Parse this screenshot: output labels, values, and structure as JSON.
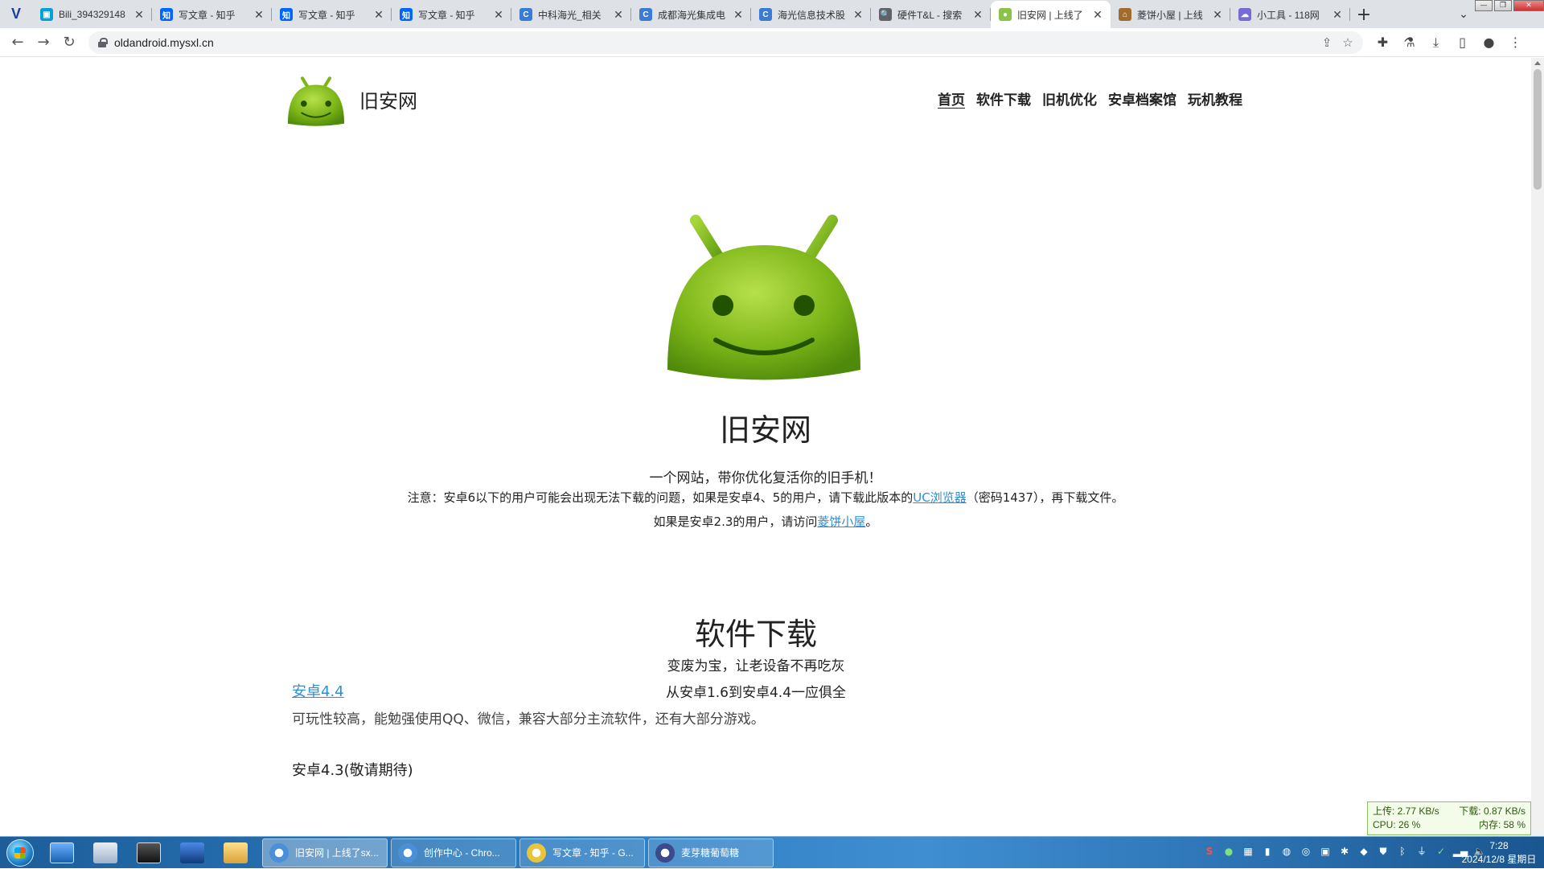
{
  "browser": {
    "tabs": [
      {
        "title": "Bili_394329148",
        "fav_color": "#00a1d6",
        "fav_glyph": "▣"
      },
      {
        "title": "写文章 - 知乎",
        "fav_color": "#0066ff",
        "fav_glyph": "知"
      },
      {
        "title": "写文章 - 知乎",
        "fav_color": "#0066ff",
        "fav_glyph": "知"
      },
      {
        "title": "写文章 - 知乎",
        "fav_color": "#0066ff",
        "fav_glyph": "知"
      },
      {
        "title": "中科海光_相关",
        "fav_color": "#3a7bd5",
        "fav_glyph": "C"
      },
      {
        "title": "成都海光集成电",
        "fav_color": "#3a7bd5",
        "fav_glyph": "C"
      },
      {
        "title": "海光信息技术股",
        "fav_color": "#3a7bd5",
        "fav_glyph": "C"
      },
      {
        "title": "硬件T&L - 搜索",
        "fav_color": "#5f6368",
        "fav_glyph": "🔍"
      },
      {
        "title": "旧安网 | 上线了",
        "fav_color": "#8bc34a",
        "fav_glyph": "●",
        "active": true
      },
      {
        "title": "菱饼小屋 | 上线",
        "fav_color": "#a36b2b",
        "fav_glyph": "⌂"
      },
      {
        "title": "小工具 - 118网",
        "fav_color": "#7a6ad8",
        "fav_glyph": "☁"
      }
    ],
    "new_tab_label": "+",
    "url": "oldandroid.mysxl.cn",
    "window_controls": [
      "—",
      "❐",
      "✕"
    ]
  },
  "site": {
    "name": "旧安网",
    "nav": [
      "首页",
      "软件下载",
      "旧机优化",
      "安卓档案馆",
      "玩机教程"
    ],
    "hero_title": "旧安网",
    "tagline": "一个网站，带你优化复活你的旧手机！",
    "notice_pre": "注意：安卓6以下的用户可能会出现无法下载的问题，如果是安卓4、5的用户，请下载此版本的",
    "notice_link": "UC浏览器",
    "notice_post": "（密码1437），再下载文件。",
    "android23_pre": "如果是安卓2.3的用户，请访问",
    "android23_link": "菱饼小屋",
    "android23_post": "。",
    "section_title": "软件下载",
    "section_sub1": "变废为宝，让老设备不再吃灰",
    "section_sub2": "从安卓1.6到安卓4.4一应俱全",
    "item1_link": "安卓4.4",
    "item1_desc": "可玩性较高，能勉强使用QQ、微信，兼容大部分主流软件，还有大部分游戏。",
    "item2_title": "安卓4.3(敬请期待)",
    "android_green": "#8bc34a"
  },
  "netmon": {
    "upload": "上传: 2.77 KB/s",
    "download": "下载: 0.87 KB/s",
    "cpu": "CPU: 26 %",
    "mem": "内存: 58 %"
  },
  "taskbar": {
    "tasks": [
      {
        "label": "旧安网 | 上线了sx...",
        "active": true
      },
      {
        "label": "创作中心 - Chro..."
      },
      {
        "label": "写文章 - 知乎 - G..."
      },
      {
        "label": "麦芽糖葡萄糖"
      }
    ],
    "time": "7:28",
    "date": "2024/12/8 星期日"
  }
}
